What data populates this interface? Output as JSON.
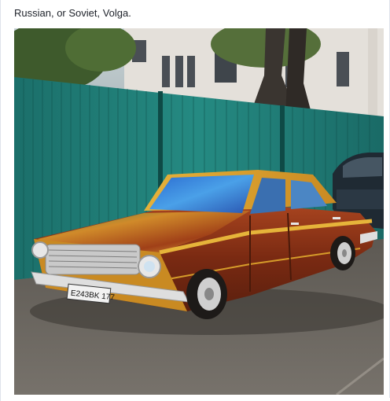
{
  "post": {
    "caption": "Russian, or Soviet, Volga.",
    "photo": {
      "plate_text": "E243BK 177"
    }
  },
  "colors": {
    "fence": "#1f7c76",
    "car_body": "#8b2e14",
    "car_trim": "#e0a52a",
    "road": "#6b6660",
    "building": "#e6e2dc"
  }
}
